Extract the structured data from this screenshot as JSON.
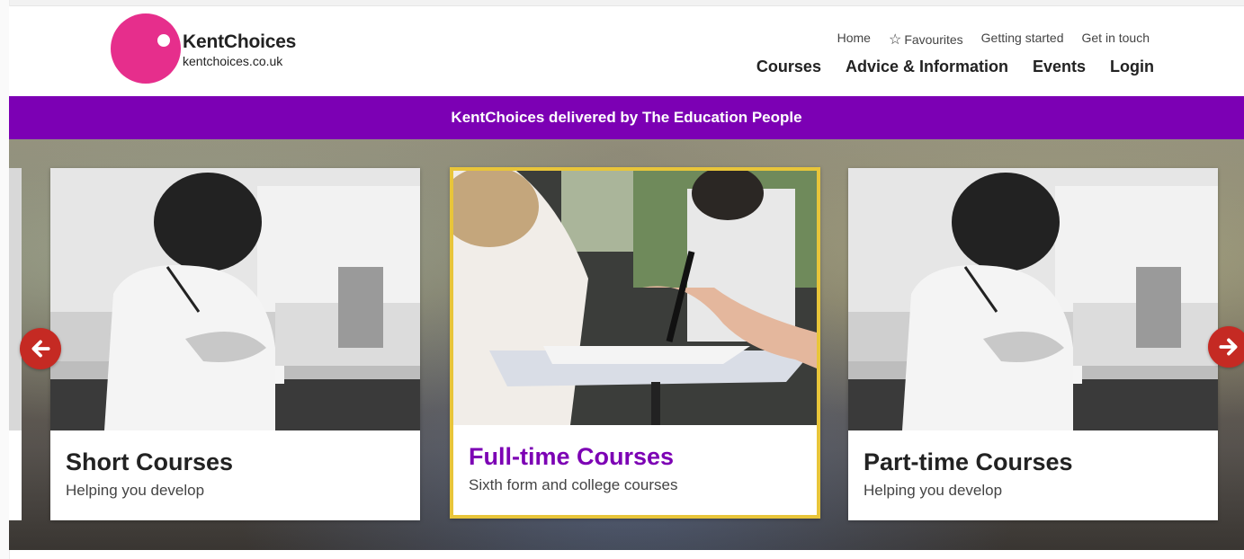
{
  "logo": {
    "name": "KentChoices",
    "url": "kentchoices.co.uk",
    "circle_color": "#e62e8c"
  },
  "util_nav": {
    "home": "Home",
    "favourites": "Favourites",
    "getting_started": "Getting started",
    "get_in_touch": "Get in touch"
  },
  "main_nav": {
    "courses": "Courses",
    "advice": "Advice & Information",
    "events": "Events",
    "login": "Login"
  },
  "banner": {
    "text": "KentChoices delivered by The Education People",
    "color": "#7c00b4"
  },
  "carousel": {
    "cards": [
      {
        "title": "Short Courses",
        "subtitle": "Helping you develop",
        "image": "student-writing-grayscale"
      },
      {
        "title": "Full-time Courses",
        "subtitle": "Sixth form and college courses",
        "image": "students-exam-color",
        "active": true
      },
      {
        "title": "Part-time Courses",
        "subtitle": "Helping you develop",
        "image": "student-writing-grayscale"
      }
    ],
    "prev_icon": "arrow-left-icon",
    "next_icon": "arrow-right-icon",
    "accent_color": "#c52a23",
    "active_border_color": "#e8c53a"
  }
}
